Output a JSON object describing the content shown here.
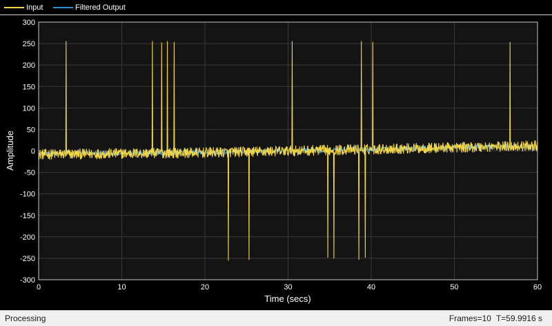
{
  "legend": {
    "items": [
      {
        "label": "Input",
        "color": "#f0d44a"
      },
      {
        "label": "Filtered Output",
        "color": "#2f8fd6"
      }
    ]
  },
  "status": {
    "state": "Processing",
    "frames": "Frames=10",
    "time": "T=59.9916 s"
  },
  "chart_data": {
    "type": "line",
    "xlabel": "Time (secs)",
    "ylabel": "Amplitude",
    "xlim": [
      0,
      60
    ],
    "ylim": [
      -300,
      300
    ],
    "xticks": [
      0,
      10,
      20,
      30,
      40,
      50,
      60
    ],
    "yticks": [
      300,
      250,
      200,
      150,
      100,
      50,
      0,
      -50,
      -100,
      -150,
      -200,
      -250,
      -300
    ],
    "grid": true,
    "background": "#141414",
    "legend_position": "top",
    "series": [
      {
        "name": "Input",
        "color": "#f0d44a",
        "baseline": {
          "x": [
            0,
            10,
            20,
            30,
            40,
            50,
            60
          ],
          "y": [
            -8,
            -6,
            -4,
            0,
            4,
            8,
            12
          ]
        },
        "noise_amplitude": 12,
        "spikes": [
          {
            "x": 3.3,
            "y": 255
          },
          {
            "x": 13.7,
            "y": 255
          },
          {
            "x": 14.8,
            "y": 252
          },
          {
            "x": 15.5,
            "y": 255
          },
          {
            "x": 16.3,
            "y": 253
          },
          {
            "x": 22.8,
            "y": -255
          },
          {
            "x": 25.3,
            "y": -253
          },
          {
            "x": 30.5,
            "y": 255
          },
          {
            "x": 34.8,
            "y": -248
          },
          {
            "x": 35.5,
            "y": -250
          },
          {
            "x": 38.5,
            "y": -253
          },
          {
            "x": 38.8,
            "y": 255
          },
          {
            "x": 39.3,
            "y": -248
          },
          {
            "x": 40.2,
            "y": 253
          },
          {
            "x": 56.7,
            "y": 253
          }
        ]
      },
      {
        "name": "Filtered Output",
        "color": "#2f8fd6",
        "baseline": {
          "x": [
            0,
            10,
            20,
            30,
            40,
            50,
            60
          ],
          "y": [
            -6,
            -5,
            -3,
            0,
            4,
            8,
            11
          ]
        },
        "noise_amplitude": 5
      }
    ]
  }
}
